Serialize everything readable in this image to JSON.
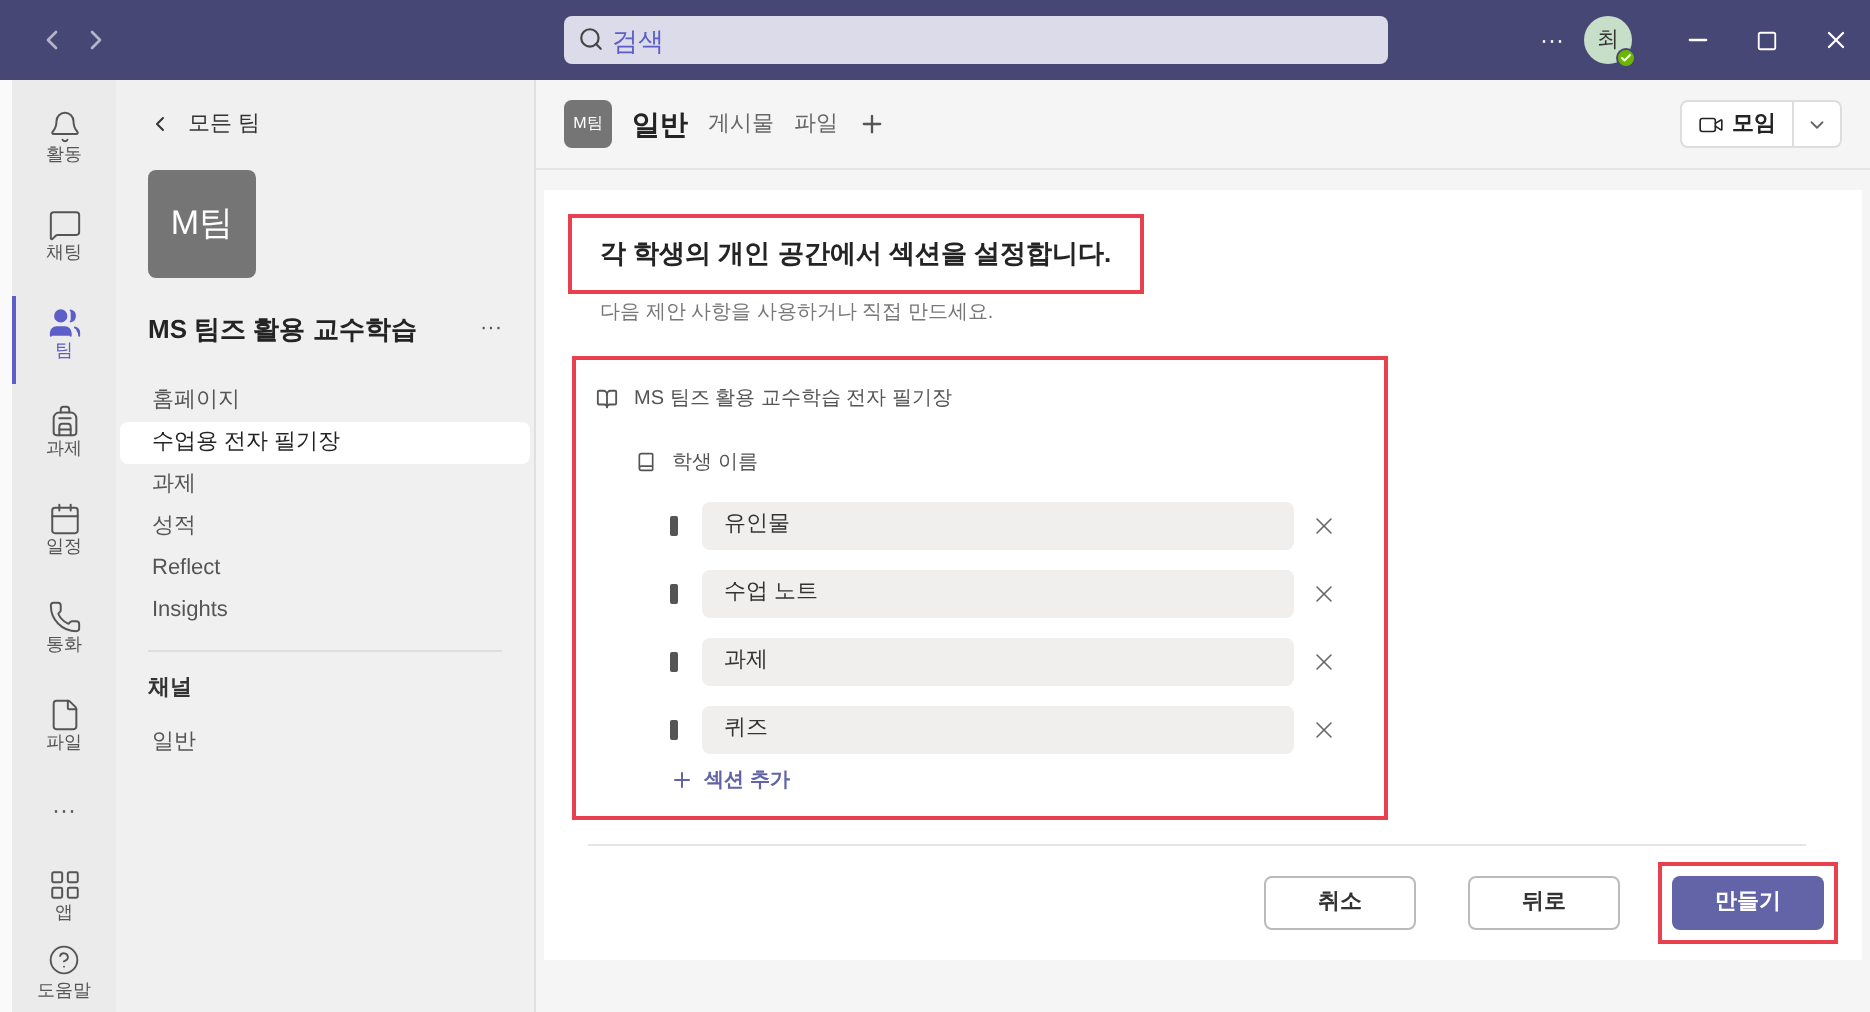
{
  "titlebar": {
    "search_placeholder": "검색",
    "more": "···",
    "avatar": "최"
  },
  "rail": [
    {
      "label": "활동",
      "selected": false
    },
    {
      "label": "채팅",
      "selected": false
    },
    {
      "label": "팀",
      "selected": true
    },
    {
      "label": "과제",
      "selected": false
    },
    {
      "label": "일정",
      "selected": false
    },
    {
      "label": "통화",
      "selected": false
    },
    {
      "label": "파일",
      "selected": false
    },
    {
      "label": "···",
      "selected": false
    },
    {
      "label": "앱",
      "selected": false
    }
  ],
  "rail_help": {
    "label": "도움말"
  },
  "team_panel": {
    "back": "모든 팀",
    "avatar": "M팀",
    "name": "MS 팀즈 활용 교수학습",
    "more": "···",
    "items": [
      {
        "label": "홈페이지",
        "selected": false
      },
      {
        "label": "수업용 전자 필기장",
        "selected": true
      },
      {
        "label": "과제",
        "selected": false
      },
      {
        "label": "성적",
        "selected": false
      },
      {
        "label": "Reflect",
        "selected": false
      },
      {
        "label": "Insights",
        "selected": false
      }
    ],
    "channels_heading": "채널",
    "channels": [
      {
        "label": "일반",
        "selected": false
      }
    ]
  },
  "header": {
    "avatar": "M팀",
    "channel": "일반",
    "tabs": [
      {
        "label": "게시물",
        "selected": false
      },
      {
        "label": "파일",
        "selected": false
      }
    ],
    "meet": "모임"
  },
  "dialog": {
    "title": "각 학생의 개인 공간에서 섹션을 설정합니다.",
    "title_highlighted": true,
    "subtitle": "다음 제안 사항을 사용하거나 직접 만드세요.",
    "notebook": "MS 팀즈 활용 교수학습 전자 필기장",
    "student": "학생 이름",
    "sections": [
      "유인물",
      "수업 노트",
      "과제",
      "퀴즈"
    ],
    "add_section": "섹션 추가",
    "sections_highlighted": true,
    "buttons": [
      {
        "label": "취소",
        "kind": "secondary",
        "highlighted": false
      },
      {
        "label": "뒤로",
        "kind": "secondary",
        "highlighted": false
      },
      {
        "label": "만들기",
        "kind": "primary",
        "highlighted": true
      }
    ]
  }
}
